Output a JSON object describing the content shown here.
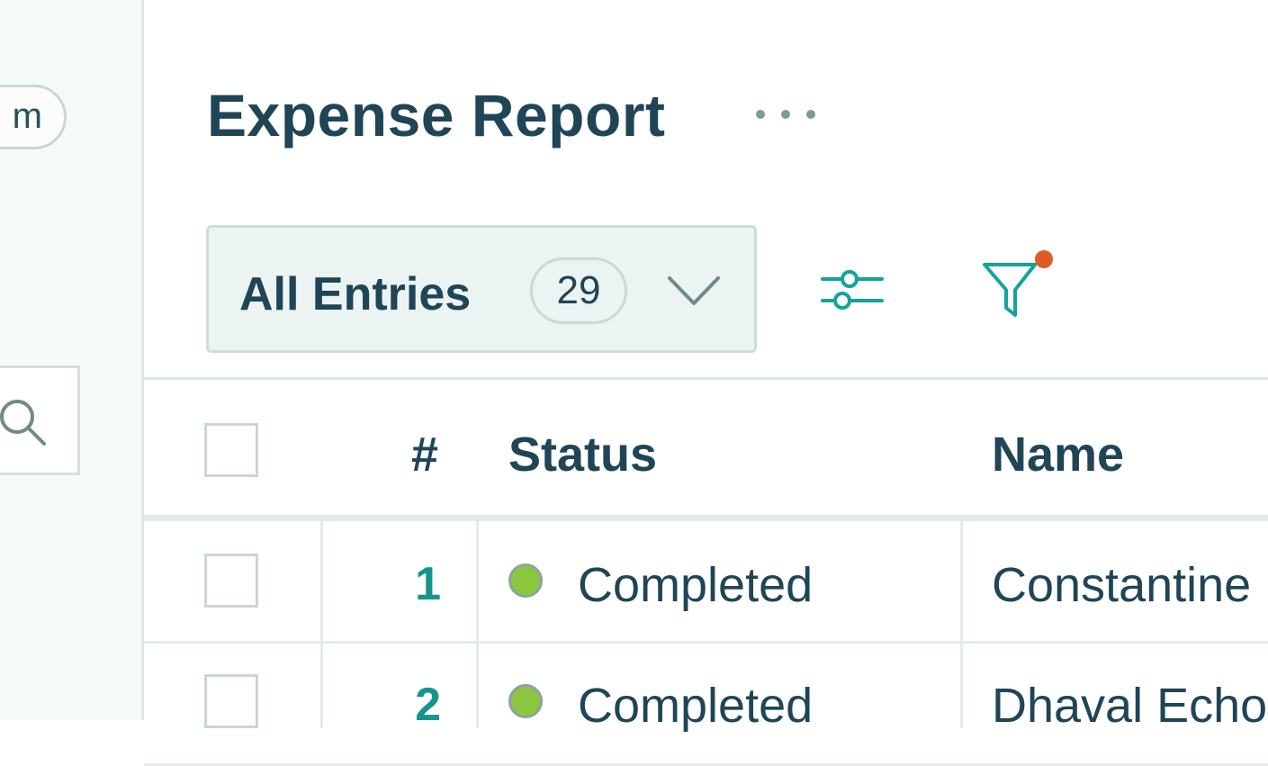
{
  "sidebar": {
    "pill_text": "m"
  },
  "header": {
    "title": "Expense Report"
  },
  "view_select": {
    "label": "All Entries",
    "count": "29"
  },
  "table": {
    "columns": [
      "#",
      "Status",
      "Name"
    ],
    "rows": [
      {
        "number": "1",
        "status": "Completed",
        "name": "Constantine"
      },
      {
        "number": "2",
        "status": "Completed",
        "name": "Dhaval Echo"
      }
    ]
  },
  "colors": {
    "accent": "#14948d",
    "text": "#1f4556",
    "status_completed": "#8cc63f",
    "filter_indicator": "#dd5a2a"
  },
  "icons": [
    "search-icon",
    "more-horizontal-icon",
    "chevron-down-icon",
    "sliders-icon",
    "filter-icon"
  ]
}
